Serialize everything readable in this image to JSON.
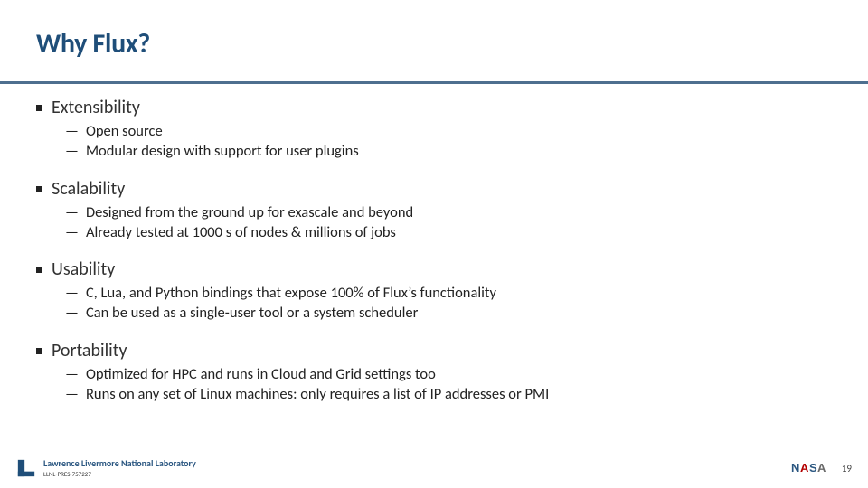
{
  "title": "Why Flux?",
  "sections": [
    {
      "heading": "Extensibility",
      "items": [
        "Open source",
        "Modular design with support for user plugins"
      ]
    },
    {
      "heading": "Scalability",
      "items": [
        "Designed from the ground up for exascale and beyond",
        "Already tested at 1000 s of nodes & millions of jobs"
      ]
    },
    {
      "heading": "Usability",
      "items": [
        "C, Lua, and Python bindings that expose 100% of Flux’s functionality",
        "Can be used as a single-user tool or a system scheduler"
      ]
    },
    {
      "heading": "Portability",
      "items": [
        "Optimized for HPC and runs in Cloud and Grid settings too",
        "Runs on any set of Linux machines: only requires a list of IP addresses or PMI"
      ]
    }
  ],
  "footer": {
    "lab_name": "Lawrence Livermore National Laboratory",
    "doc_code": "LLNL-PRES-757227",
    "page_number": "19"
  }
}
